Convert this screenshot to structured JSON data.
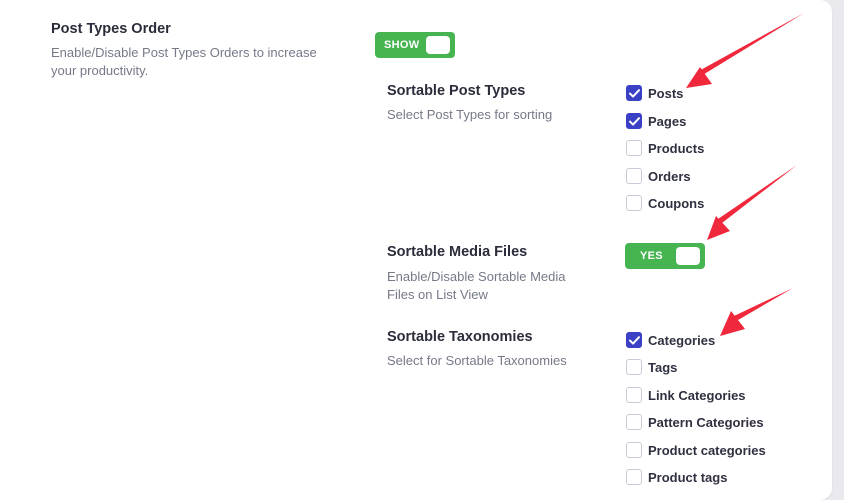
{
  "post_types_order": {
    "title": "Post Types Order",
    "description": "Enable/Disable Post Types Orders to increase your productivity.",
    "toggle_label": "SHOW"
  },
  "sortable_post_types": {
    "title": "Sortable Post Types",
    "description": "Select Post Types for sorting",
    "options": [
      {
        "label": "Posts",
        "checked": true
      },
      {
        "label": "Pages",
        "checked": true
      },
      {
        "label": "Products",
        "checked": false
      },
      {
        "label": "Orders",
        "checked": false
      },
      {
        "label": "Coupons",
        "checked": false
      }
    ]
  },
  "sortable_media_files": {
    "title": "Sortable Media Files",
    "description": "Enable/Disable Sortable Media Files on List View",
    "toggle_label": "YES"
  },
  "sortable_taxonomies": {
    "title": "Sortable Taxonomies",
    "description": "Select for Sortable Taxonomies",
    "options": [
      {
        "label": "Categories",
        "checked": true
      },
      {
        "label": "Tags",
        "checked": false
      },
      {
        "label": "Link Categories",
        "checked": false
      },
      {
        "label": "Pattern Categories",
        "checked": false
      },
      {
        "label": "Product categories",
        "checked": false
      },
      {
        "label": "Product tags",
        "checked": false
      }
    ]
  },
  "colors": {
    "toggle_on": "#46b450",
    "checkbox_checked": "#3b41c7",
    "arrow": "#f0283c"
  }
}
